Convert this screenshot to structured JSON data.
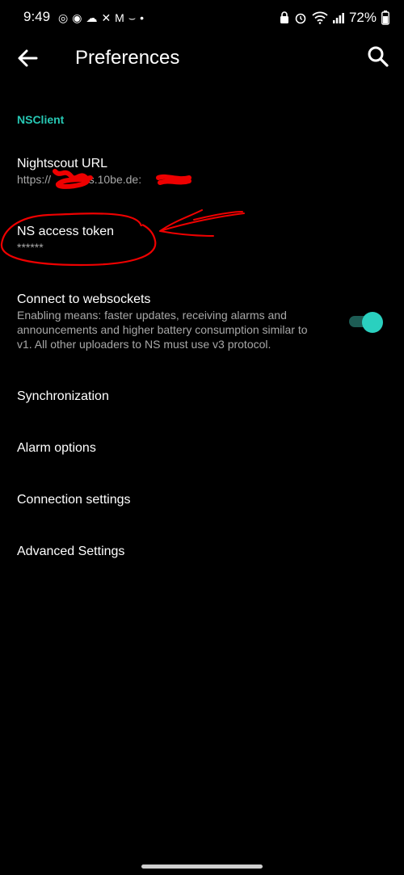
{
  "status_bar": {
    "time": "9:49",
    "battery_percent": "72%",
    "left_icons": [
      "whatsapp-icon",
      "threads-icon",
      "cloud-icon",
      "app-icon",
      "gmail-icon",
      "amazon-icon",
      "dot-icon"
    ],
    "right_icons": [
      "lock-icon",
      "alarm-icon",
      "wifi-icon",
      "signal-icon",
      "battery-icon"
    ]
  },
  "app_bar": {
    "title": "Preferences"
  },
  "section": {
    "category_label": "NSClient",
    "accent_color": "#27c8b4"
  },
  "prefs": {
    "nightscout_url": {
      "title": "Nightscout URL",
      "summary": "https://          ns.10be.de:"
    },
    "ns_access_token": {
      "title": "NS access token",
      "summary": "******"
    },
    "websockets": {
      "title": "Connect to websockets",
      "summary": "Enabling means: faster updates, receiving alarms and announcements and higher battery consumption similar to v1. All other uploaders to NS must use v3 protocol.",
      "enabled": true
    },
    "synchronization": {
      "title": "Synchronization"
    },
    "alarm_options": {
      "title": "Alarm options"
    },
    "connection_settings": {
      "title": "Connection settings"
    },
    "advanced_settings": {
      "title": "Advanced Settings"
    }
  }
}
